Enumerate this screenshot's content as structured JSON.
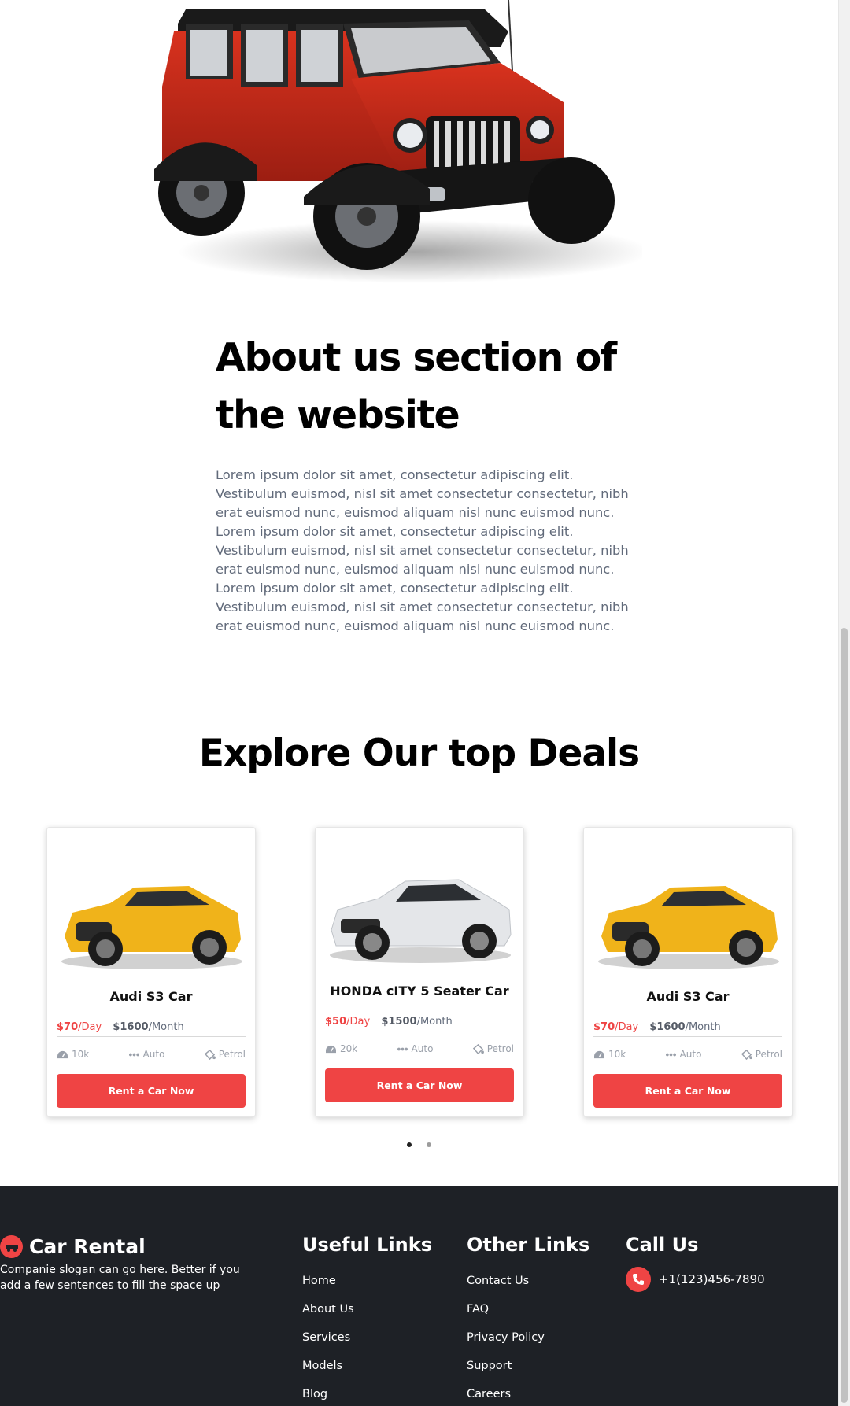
{
  "about": {
    "title": "About us section of the website",
    "body": "Lorem ipsum dolor sit amet, consectetur adipiscing elit. Vestibulum euismod, nisl sit amet consectetur consectetur, nibh erat euismod nunc, euismod aliquam nisl nunc euismod nunc. Lorem ipsum dolor sit amet, consectetur adipiscing elit. Vestibulum euismod, nisl sit amet consectetur consectetur, nibh erat euismod nunc, euismod aliquam nisl nunc euismod nunc. Lorem ipsum dolor sit amet, consectetur adipiscing elit. Vestibulum euismod, nisl sit amet consectetur consectetur, nibh erat euismod nunc, euismod aliquam nisl nunc euismod nunc."
  },
  "deals": {
    "title": "Explore Our top Deals",
    "cards": [
      {
        "name": "Audi S3 Car",
        "day_price": "$70",
        "day_unit": "/Day",
        "month_price": "$1600",
        "month_unit": "/Month",
        "mileage": "10k",
        "transmission": "Auto",
        "fuel": "Petrol",
        "button": "Rent a Car Now",
        "color": "#f0b31a"
      },
      {
        "name": "HONDA cITY 5 Seater Car",
        "day_price": "$50",
        "day_unit": "/Day",
        "month_price": "$1500",
        "month_unit": "/Month",
        "mileage": "20k",
        "transmission": "Auto",
        "fuel": "Petrol",
        "button": "Rent a Car Now",
        "color": "#e4e6e9"
      },
      {
        "name": "Audi S3 Car",
        "day_price": "$70",
        "day_unit": "/Day",
        "month_price": "$1600",
        "month_unit": "/Month",
        "mileage": "10k",
        "transmission": "Auto",
        "fuel": "Petrol",
        "button": "Rent a Car Now",
        "color": "#f0b31a"
      }
    ],
    "carousel_active_index": 0,
    "carousel_count": 2
  },
  "footer": {
    "brand": "Car Rental",
    "slogan": "Companie slogan can go here. Better if you add a few sentences to fill the space up",
    "useful_links": {
      "title": "Useful Links",
      "items": [
        "Home",
        "About Us",
        "Services",
        "Models",
        "Blog"
      ]
    },
    "other_links": {
      "title": "Other Links",
      "items": [
        "Contact Us",
        "FAQ",
        "Privacy Policy",
        "Support",
        "Careers"
      ]
    },
    "call_us": {
      "title": "Call Us",
      "phone": "+1(123)456-7890"
    }
  },
  "colors": {
    "accent": "#ef4444",
    "footer_bg": "#1e2126",
    "jeep_body": "#c92a18"
  }
}
